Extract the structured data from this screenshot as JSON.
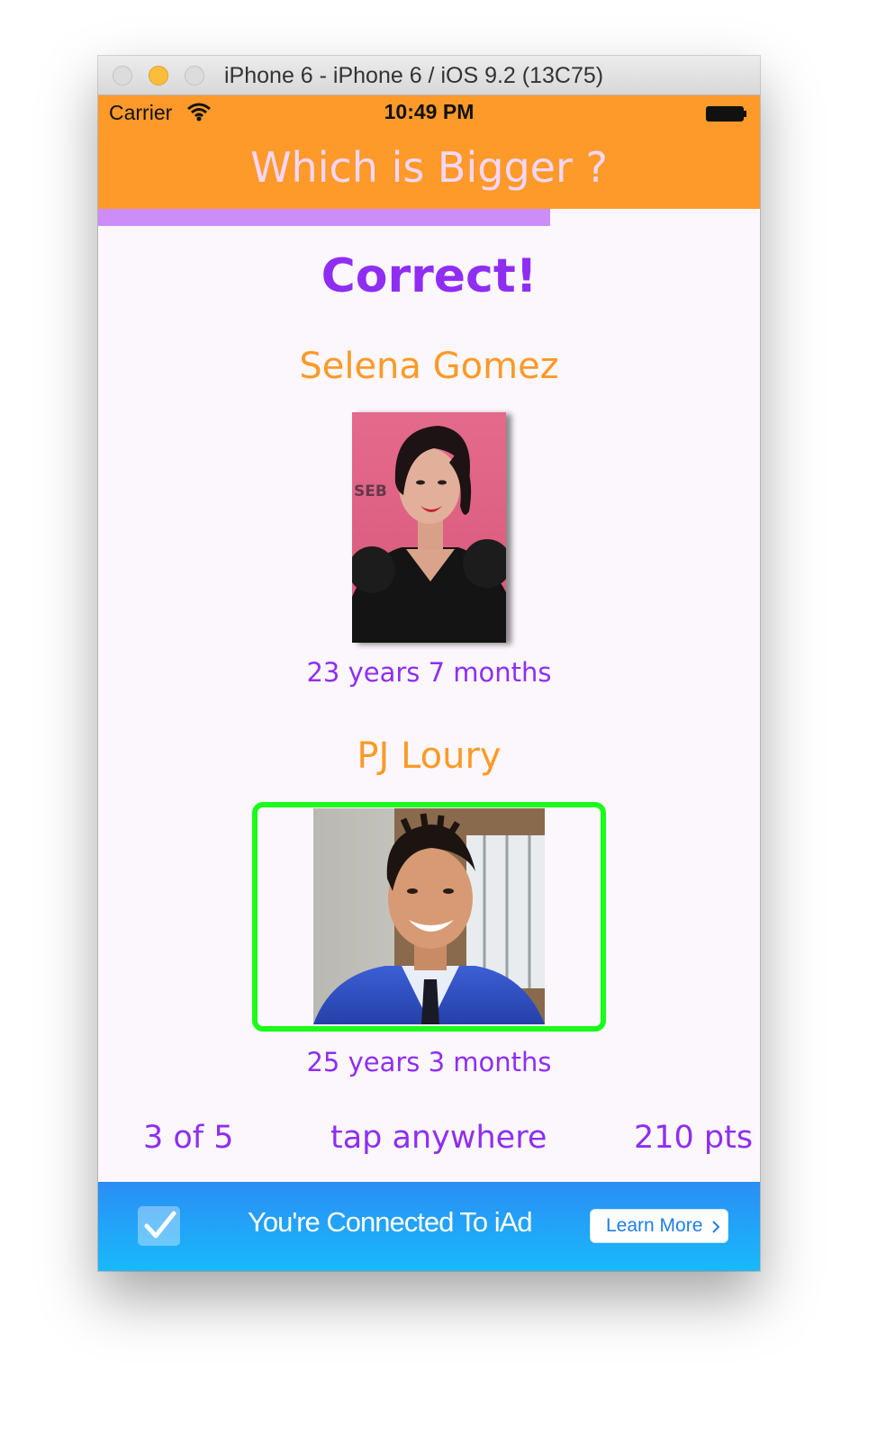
{
  "window": {
    "title": "iPhone 6 - iPhone 6 / iOS 9.2 (13C75)"
  },
  "status_bar": {
    "carrier": "Carrier",
    "time": "10:49 PM"
  },
  "nav": {
    "title": "Which is Bigger ?"
  },
  "progress": {
    "fraction": 0.683,
    "color": "#cc8cf9"
  },
  "result": {
    "text": "Correct!"
  },
  "celebrity_1": {
    "name": "Selena Gomez",
    "age": "23 years 7 months",
    "selected": false
  },
  "celebrity_2": {
    "name": "PJ Loury",
    "age": "25 years 3 months",
    "selected": true
  },
  "footer": {
    "round": "3 of 5",
    "hint": "tap anywhere",
    "score": "210 pts"
  },
  "ad": {
    "text": "You're Connected To iAd",
    "button_label": "Learn More",
    "icon": "checkmark-icon",
    "button_icon": "chevron-right-icon"
  },
  "colors": {
    "accent_orange": "#fd9a2a",
    "accent_purple": "#8f2ef2",
    "nav_title": "#f5d6f7",
    "selected_border": "#1afc1a",
    "ad_blue": "#2a8ef5"
  }
}
